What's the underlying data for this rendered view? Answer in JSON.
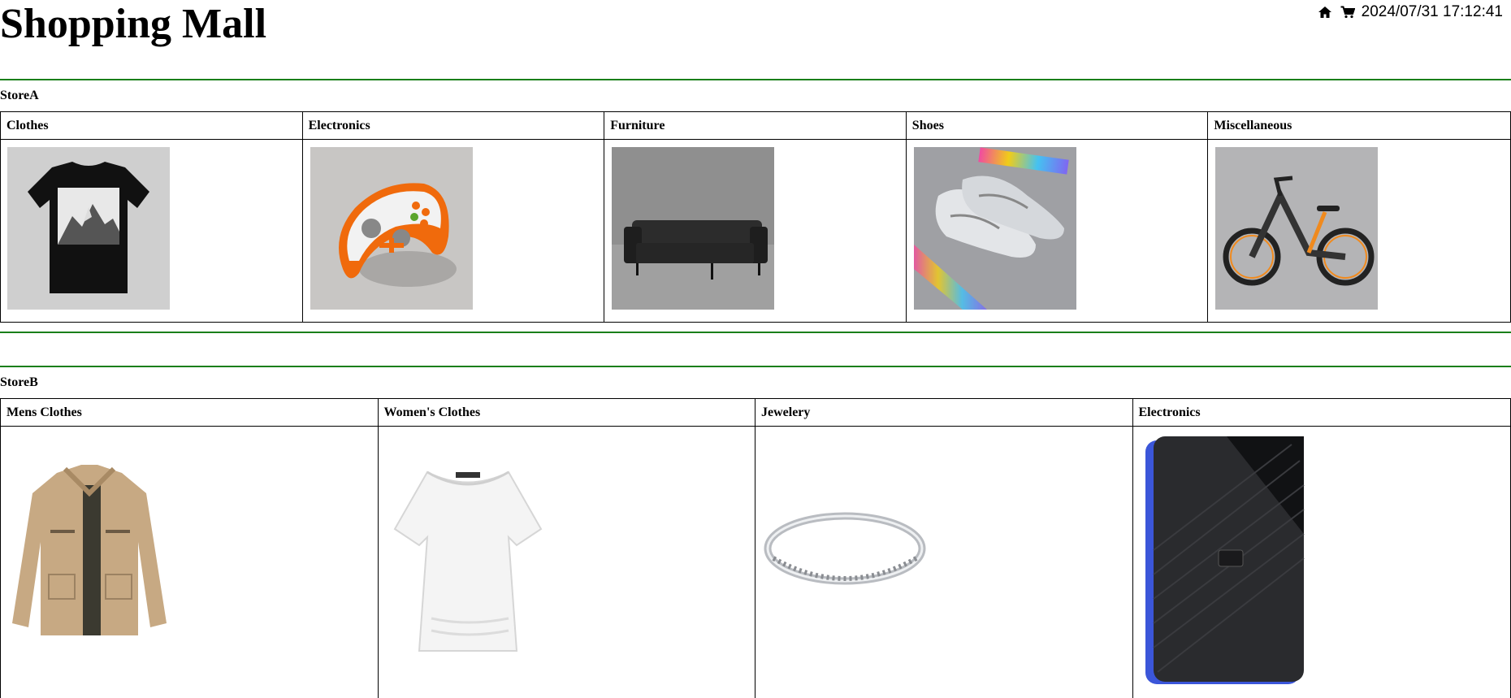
{
  "header": {
    "title": "Shopping Mall",
    "datetime": "2024/07/31 17:12:41",
    "icons": [
      "home-icon",
      "cart-icon"
    ]
  },
  "stores": [
    {
      "name": "StoreA",
      "categories": [
        {
          "label": "Clothes",
          "image": "black mountain t-shirt"
        },
        {
          "label": "Electronics",
          "image": "orange white game controller"
        },
        {
          "label": "Furniture",
          "image": "black leather sofa"
        },
        {
          "label": "Shoes",
          "image": "silver holographic sneakers"
        },
        {
          "label": "Miscellaneous",
          "image": "electric bicycle"
        }
      ]
    },
    {
      "name": "StoreB",
      "categories": [
        {
          "label": "Mens Clothes",
          "image": "khaki jacket"
        },
        {
          "label": "Women's Clothes",
          "image": "white blouse"
        },
        {
          "label": "Jewelery",
          "image": "silver diamond ring"
        },
        {
          "label": "Electronics",
          "image": "portable hard drive"
        }
      ]
    }
  ],
  "colors": {
    "divider": "#1a7f1a",
    "border": "#000000"
  }
}
